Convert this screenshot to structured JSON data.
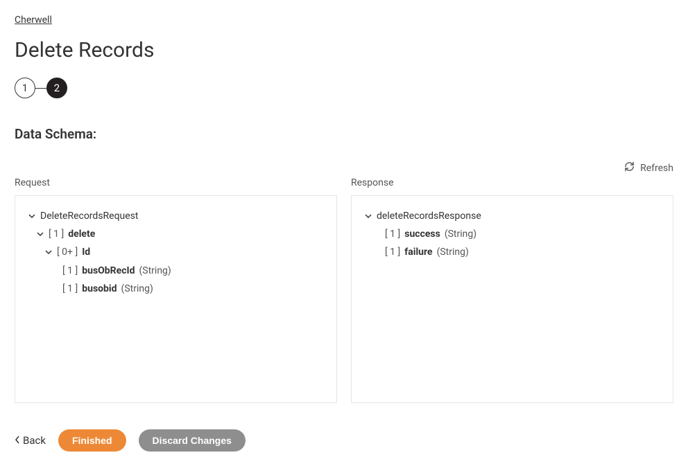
{
  "breadcrumb": "Cherwell",
  "title": "Delete Records",
  "stepper": {
    "step1": "1",
    "step2": "2"
  },
  "section_title": "Data Schema:",
  "refresh_label": "Refresh",
  "request": {
    "label": "Request",
    "root": "DeleteRecordsRequest",
    "delete": {
      "card": "[ 1 ]",
      "name": "delete"
    },
    "id": {
      "card": "[ 0+ ]",
      "name": "Id"
    },
    "busObRecId": {
      "card": "[ 1 ]",
      "name": "busObRecId",
      "type": "(String)"
    },
    "busobid": {
      "card": "[ 1 ]",
      "name": "busobid",
      "type": "(String)"
    }
  },
  "response": {
    "label": "Response",
    "root": "deleteRecordsResponse",
    "success": {
      "card": "[ 1 ]",
      "name": "success",
      "type": "(String)"
    },
    "failure": {
      "card": "[ 1 ]",
      "name": "failure",
      "type": "(String)"
    }
  },
  "footer": {
    "back": "Back",
    "finished": "Finished",
    "discard": "Discard Changes"
  }
}
